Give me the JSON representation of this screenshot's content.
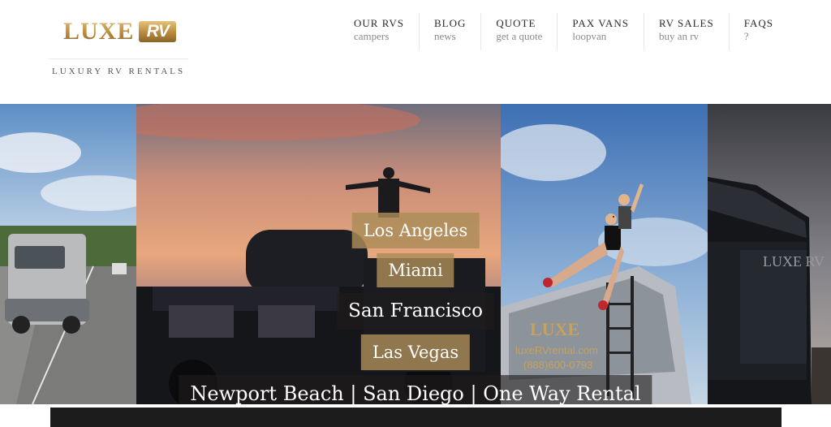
{
  "brand": {
    "logo_text": "LUXE",
    "logo_badge": "RV",
    "tagline": "LUXURY RV RENTALS"
  },
  "nav": [
    {
      "label": "OUR RVS",
      "sub": "campers"
    },
    {
      "label": "BLOG",
      "sub": "news"
    },
    {
      "label": "QUOTE",
      "sub": "get a quote"
    },
    {
      "label": "PAX VANS",
      "sub": "loopvan"
    },
    {
      "label": "RV SALES",
      "sub": "buy an rv"
    },
    {
      "label": "FAQS",
      "sub": "?"
    }
  ],
  "hero": {
    "cities": [
      "Los Angeles",
      "Miami",
      "San Francisco",
      "Las Vegas"
    ],
    "bottom_links": [
      "Newport Beach",
      "San Diego",
      "One Way Rental"
    ],
    "separator": " | ",
    "van_brand": "LUXE",
    "van_site": "luxeRVrental.com",
    "van_phone": "(888)600-0793",
    "coach_brand": "LUXE RV"
  },
  "colors": {
    "gold": "#ab8c58",
    "nav_text": "#2b2b2b",
    "nav_sub": "#8c8c8c",
    "footer_bar": "#1c1c1c"
  }
}
